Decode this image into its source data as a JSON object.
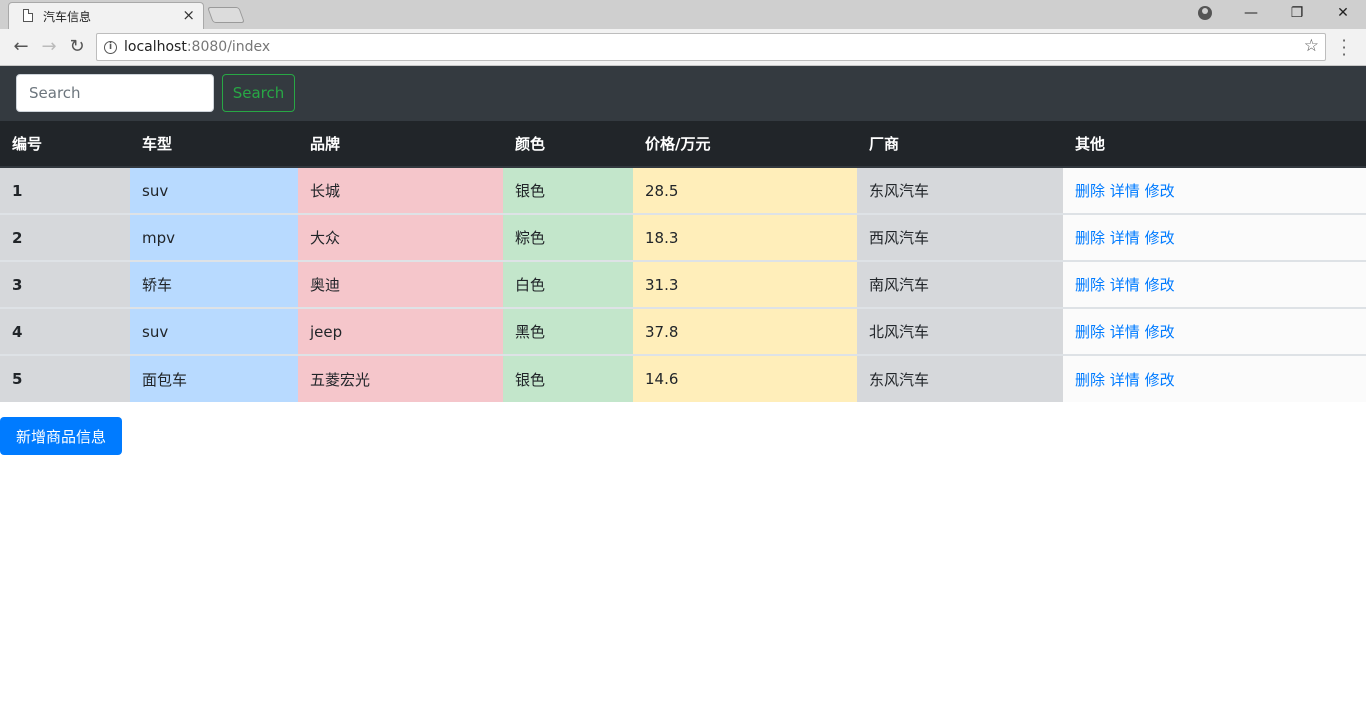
{
  "browser": {
    "tab_title": "汽车信息",
    "tab_close": "×",
    "url_host": "localhost",
    "url_rest": ":8080/index",
    "back": "←",
    "forward": "→",
    "reload": "↻",
    "star": "☆",
    "minimize": "—",
    "restore": "❐",
    "close": "✕"
  },
  "navbar": {
    "search_placeholder": "Search",
    "search_button": "Search"
  },
  "table": {
    "headers": [
      "编号",
      "车型",
      "品牌",
      "颜色",
      "价格/万元",
      "厂商",
      "其他"
    ],
    "rows": [
      {
        "id": "1",
        "type": "suv",
        "brand": "长城",
        "color": "银色",
        "price": "28.5",
        "maker": "东风汽车"
      },
      {
        "id": "2",
        "type": "mpv",
        "brand": "大众",
        "color": "粽色",
        "price": "18.3",
        "maker": "西风汽车"
      },
      {
        "id": "3",
        "type": "轿车",
        "brand": "奥迪",
        "color": "白色",
        "price": "31.3",
        "maker": "南风汽车"
      },
      {
        "id": "4",
        "type": "suv",
        "brand": "jeep",
        "color": "黑色",
        "price": "37.8",
        "maker": "北风汽车"
      },
      {
        "id": "5",
        "type": "面包车",
        "brand": "五菱宏光",
        "color": "银色",
        "price": "14.6",
        "maker": "东风汽车"
      }
    ],
    "actions": {
      "delete": "删除",
      "detail": "详情",
      "edit": "修改"
    }
  },
  "add_button": "新增商品信息",
  "colors": {
    "navbar": "#343a40",
    "header": "#212529",
    "success": "#28a745",
    "primary": "#007bff",
    "row_secondary": "#d6d8db",
    "row_primary": "#b8daff",
    "row_danger": "#f5c6cb",
    "row_success": "#c3e6cb",
    "row_warning": "#ffeeba"
  }
}
